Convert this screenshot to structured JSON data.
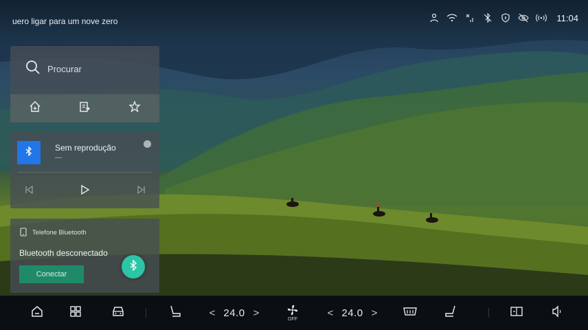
{
  "status_bar": {
    "voice_prompt": "uero ligar para um nove zero",
    "clock": "11:04",
    "icons": [
      "person-icon",
      "wifi-icon",
      "signal-off-icon",
      "bluetooth-off-icon",
      "shield-icon",
      "eye-off-icon",
      "hotspot-icon"
    ]
  },
  "search_card": {
    "placeholder": "Procurar",
    "quick_actions": [
      "home-nav-icon",
      "work-nav-icon",
      "star-icon"
    ]
  },
  "media_card": {
    "title": "Sem reprodução",
    "subtitle": "—",
    "controls": [
      "previous-icon",
      "play-icon",
      "next-icon"
    ]
  },
  "phone_card": {
    "title": "Telefone Bluetooth",
    "status": "Bluetooth desconectado",
    "connect_label": "Conectar"
  },
  "dock": {
    "left_temp": "24.0",
    "right_temp": "24.0",
    "fan_state": "OFF",
    "chev_left": "<",
    "chev_right": ">"
  }
}
